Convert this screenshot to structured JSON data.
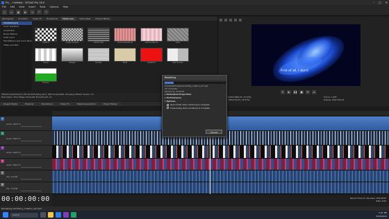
{
  "window": {
    "title": "PU_ - Untitled - VEGAS Pro 18.0"
  },
  "menu": [
    "File",
    "Edit",
    "View",
    "Insert",
    "Tools",
    "Options",
    "Help"
  ],
  "left_tabs": [
    "Workspace",
    "Scrubber",
    "Video FX",
    "Transitions",
    "Media Gen.",
    "Video Beat",
    "Project Media"
  ],
  "fx_list": [
    "Checkerboard",
    "Color Gradient",
    "Credit Roll",
    "Noise Texture",
    "Solid Color",
    "Test Pattern and Color Bars",
    "Titles and Text"
  ],
  "thumbs": [
    {
      "label": "Default",
      "pattern": "checker"
    },
    {
      "label": "Large Checker",
      "pattern": "checker2"
    },
    {
      "label": "Small Tiles",
      "pattern": "grid"
    },
    {
      "label": "Horizontal Blinds",
      "pattern": "salmon"
    },
    {
      "label": "Vertical Blinds",
      "pattern": "pink"
    },
    {
      "label": "Dots",
      "pattern": "gray"
    },
    {
      "label": "Fence",
      "pattern": "white"
    },
    {
      "label": "Shapes",
      "pattern": "mono"
    },
    {
      "label": "Bumps",
      "pattern": "stripes"
    },
    {
      "label": "Plaid",
      "pattern": "beige"
    },
    {
      "label": "Letterbox",
      "pattern": "red"
    },
    {
      "label": "Split Screen",
      "pattern": "split"
    },
    {
      "label": "Horizon",
      "pattern": "green"
    }
  ],
  "media_info": {
    "line1": "VEGAS Checkerboard, Ofx 16-bit floating point, GPU Accelerated, Grouping VEGAS, Version 1.0",
    "line2": "Description: From Magix Computer Products Intl. Co."
  },
  "bottom_tabs": [
    "Project Media",
    "Explorer",
    "Transitions",
    "Video FX",
    "Media Generators",
    "Project Notes"
  ],
  "preview": {
    "caption": "First of all, I don't",
    "frame_label": "Frame:",
    "frame_value": "1,990",
    "display_label": "Display:",
    "display_value": "629x354x32",
    "project_label": "Project:",
    "project_value": "1920x1080x32, 29.970p",
    "preview_label": "Preview:",
    "preview_value": "480x270x32, 29.970p"
  },
  "render_dialog": {
    "title": "Rendering",
    "progress_fraction": 0.15,
    "path": "E:\\Dubbed\\Output\\shorts\\My_creation_ed.mp4",
    "elapsed": "0% Complete",
    "remaining": "Remaining: 00:00:00",
    "section_props": "Estimated Properties",
    "section_perf": "Performance",
    "section_opts": "Options",
    "opt1": "Open folder when rendering is complete",
    "opt2": "Close dialog when rendering is complete",
    "cancel": "Cancel"
  },
  "tracks": [
    {
      "num": "1",
      "level": "Level: 100.0 %",
      "color": "#3b6fb0"
    },
    {
      "num": "2",
      "level": "Level: 100.0 %",
      "color": "#2e8a6a"
    },
    {
      "num": "3",
      "level": "Level: 100.0 %",
      "color": "#7a3aa0"
    },
    {
      "num": "4",
      "level": "Level: 100.0 %",
      "color": "#b03a6f"
    },
    {
      "num": "5",
      "level": "Vol: -0.0 dB",
      "color": "#6a6a6a"
    },
    {
      "num": "6",
      "level": "Vol: -0.0 dB",
      "color": "#6a6a6a"
    }
  ],
  "timecode": "00:00:00:00",
  "bottom_status": {
    "record_time": "Record Time (2 channels): 329:28:55",
    "rate": "Rate: 0.00"
  },
  "status_bar": "Rendering shorts\\my_creation_ed.mp4",
  "taskbar": {
    "search": "Search",
    "time": "4:41 PM",
    "date": "8/18/2022"
  }
}
